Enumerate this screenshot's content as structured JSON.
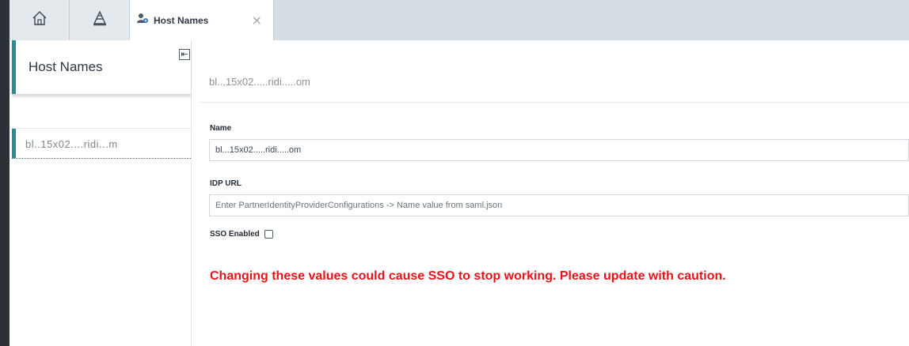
{
  "tabs": [
    {
      "icon": "home-icon"
    },
    {
      "icon": "asset-hierarchy-icon"
    },
    {
      "icon": "host-names-icon",
      "label": "Host Names",
      "close_glyph": "×",
      "active": true
    }
  ],
  "sidebar": {
    "title": "Host Names",
    "collapse_glyph": "⇤",
    "items": [
      {
        "label": "bl..15x02....ridi...m",
        "selected": true
      }
    ]
  },
  "record": {
    "title": "bl...15x02.....ridi.....om",
    "fields": {
      "name": {
        "label": "Name",
        "value": "bl...15x02.....ridi.....om"
      },
      "idp_url": {
        "label": "IDP URL",
        "value": "",
        "placeholder": "Enter PartnerIdentityProviderConfigurations -> Name value from saml.json"
      },
      "sso_enabled": {
        "label": "SSO Enabled",
        "checked": false
      }
    },
    "warning": "Changing these values could cause SSO to stop working. Please update with caution."
  },
  "colors": {
    "accent": "#2a8c93",
    "warning": "#e8121a",
    "rail": "#2b3136",
    "tabbar": "#d6dde4"
  }
}
